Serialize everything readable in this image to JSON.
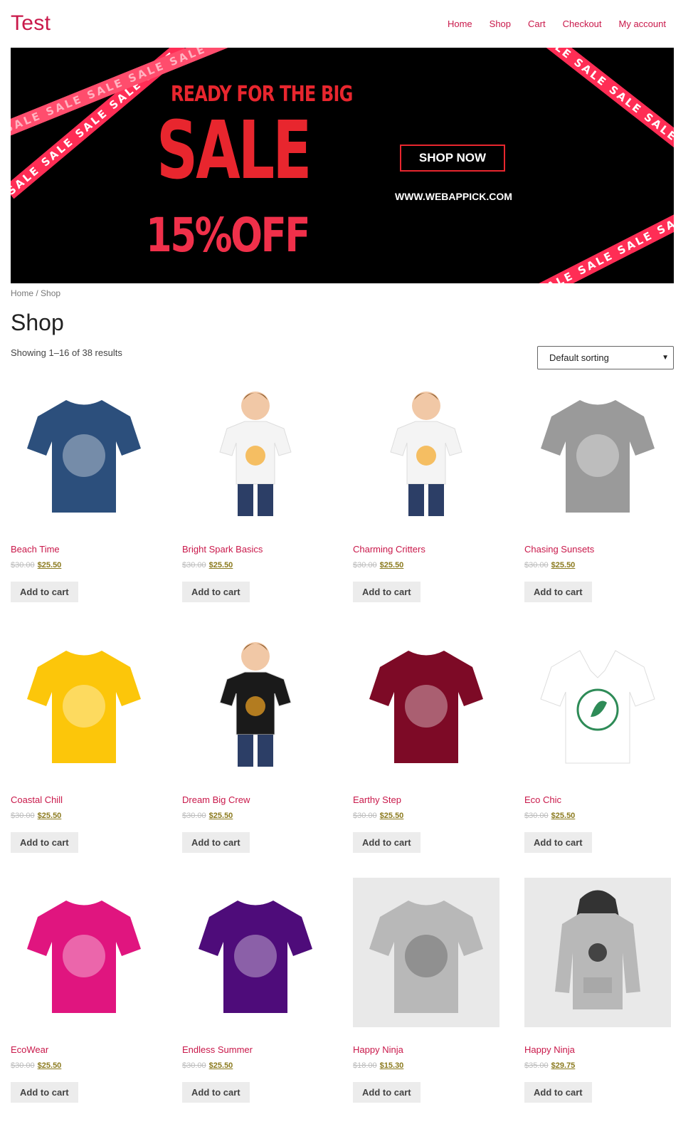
{
  "header": {
    "site_title": "Test",
    "nav": [
      "Home",
      "Shop",
      "Cart",
      "Checkout",
      "My account"
    ]
  },
  "banner": {
    "headline": "READY FOR THE BIG",
    "sale": "SALE",
    "discount": "15%OFF",
    "cta": "SHOP NOW",
    "website": "WWW.WEBAPPICK.COM",
    "tape_text": "SALE SALE SALE SALE SALE",
    "tape_color": "#ff2d55"
  },
  "breadcrumb": {
    "home": "Home",
    "separator": " / ",
    "current": "Shop"
  },
  "page_title": "Shop",
  "result_count": "Showing 1–16 of 38 results",
  "sort": {
    "selected": "Default sorting"
  },
  "products": [
    {
      "name": "Beach Time",
      "old_price": "$30.00",
      "new_price": "$25.50",
      "button": "Add to cart",
      "color": "#2c4f7c",
      "kind": "tee"
    },
    {
      "name": "Bright Spark Basics",
      "old_price": "$30.00",
      "new_price": "$25.50",
      "button": "Add to cart",
      "color": "#f4f4f4",
      "kind": "kid"
    },
    {
      "name": "Charming Critters",
      "old_price": "$30.00",
      "new_price": "$25.50",
      "button": "Add to cart",
      "color": "#f4f4f4",
      "kind": "kid"
    },
    {
      "name": "Chasing Sunsets",
      "old_price": "$30.00",
      "new_price": "$25.50",
      "button": "Add to cart",
      "color": "#9a9a9a",
      "kind": "tee"
    },
    {
      "name": "Coastal Chill",
      "old_price": "$30.00",
      "new_price": "$25.50",
      "button": "Add to cart",
      "color": "#fcc60a",
      "kind": "tee"
    },
    {
      "name": "Dream Big Crew",
      "old_price": "$30.00",
      "new_price": "$25.50",
      "button": "Add to cart",
      "color": "#1a1a1a",
      "kind": "kid"
    },
    {
      "name": "Earthy Step",
      "old_price": "$30.00",
      "new_price": "$25.50",
      "button": "Add to cart",
      "color": "#7d0a26",
      "kind": "tee"
    },
    {
      "name": "Eco Chic",
      "old_price": "$30.00",
      "new_price": "$25.50",
      "button": "Add to cart",
      "color": "#ffffff",
      "kind": "vtee"
    },
    {
      "name": "EcoWear",
      "old_price": "$30.00",
      "new_price": "$25.50",
      "button": "Add to cart",
      "color": "#e0157f",
      "kind": "tee"
    },
    {
      "name": "Endless Summer",
      "old_price": "$30.00",
      "new_price": "$25.50",
      "button": "Add to cart",
      "color": "#4e0c7a",
      "kind": "tee"
    },
    {
      "name": "Happy Ninja",
      "old_price": "$18.00",
      "new_price": "$15.30",
      "button": "Add to cart",
      "color": "#b8b8b8",
      "kind": "tee-gray"
    },
    {
      "name": "Happy Ninja",
      "old_price": "$35.00",
      "new_price": "$29.75",
      "button": "Add to cart",
      "color": "#b8b8b8",
      "kind": "hoodie"
    }
  ]
}
